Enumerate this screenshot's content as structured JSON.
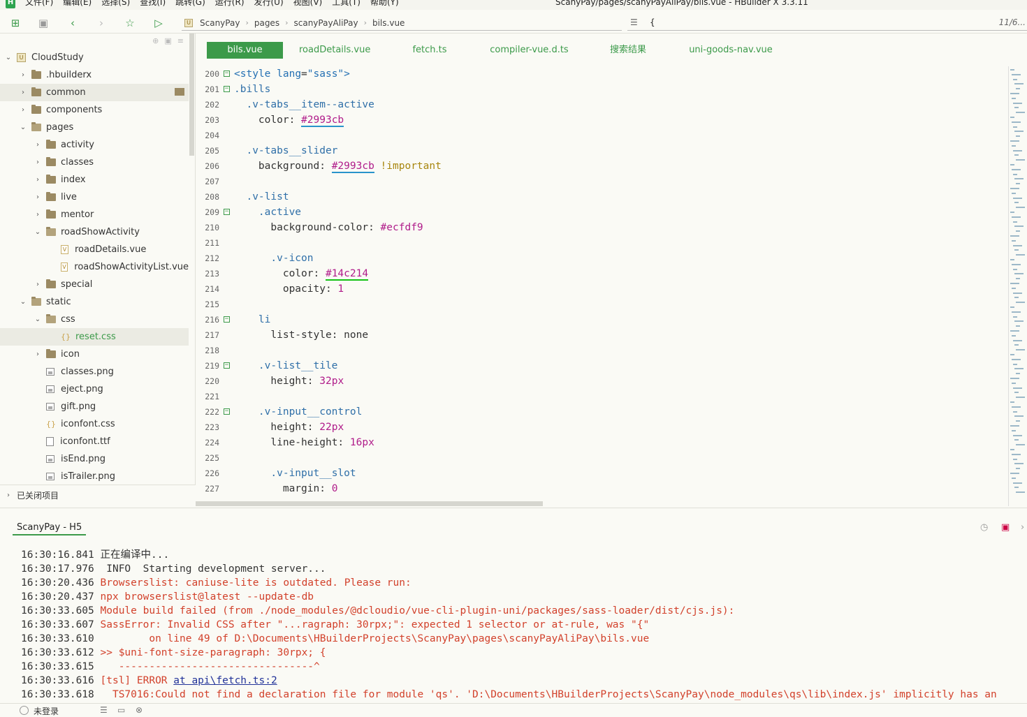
{
  "menu": {
    "logo": "H",
    "items": [
      "文件(F)",
      "编辑(E)",
      "选择(S)",
      "查找(I)",
      "跳转(G)",
      "运行(R)",
      "发行(U)",
      "视图(V)",
      "工具(T)",
      "帮助(Y)"
    ],
    "window_title": "ScanyPay/pages/scanyPayAliPay/bils.vue - HBuilder X 3.3.11"
  },
  "toolbar": {
    "buttons": [
      "new-file",
      "save",
      "back",
      "forward",
      "favorite",
      "run"
    ],
    "breadcrumb_logo": "U",
    "breadcrumb": [
      "ScanyPay",
      "pages",
      "scanyPayAliPay",
      "bils.vue"
    ],
    "search_value": "{",
    "search_count": "11/6..."
  },
  "sidebar": {
    "project_logo": "U",
    "tree": [
      {
        "label": "CloudStudy",
        "depth": 0,
        "type": "project",
        "expanded": true
      },
      {
        "label": ".hbuilderx",
        "depth": 1,
        "type": "folder",
        "expanded": false
      },
      {
        "label": "common",
        "depth": 1,
        "type": "folder",
        "expanded": false,
        "selected": true
      },
      {
        "label": "components",
        "depth": 1,
        "type": "folder",
        "expanded": false
      },
      {
        "label": "pages",
        "depth": 1,
        "type": "folder-open",
        "expanded": true
      },
      {
        "label": "activity",
        "depth": 2,
        "type": "folder",
        "expanded": false
      },
      {
        "label": "classes",
        "depth": 2,
        "type": "folder",
        "expanded": false
      },
      {
        "label": "index",
        "depth": 2,
        "type": "folder",
        "expanded": false
      },
      {
        "label": "live",
        "depth": 2,
        "type": "folder",
        "expanded": false
      },
      {
        "label": "mentor",
        "depth": 2,
        "type": "folder",
        "expanded": false
      },
      {
        "label": "roadShowActivity",
        "depth": 2,
        "type": "folder-open",
        "expanded": true
      },
      {
        "label": "roadDetails.vue",
        "depth": 3,
        "type": "vue"
      },
      {
        "label": "roadShowActivityList.vue",
        "depth": 3,
        "type": "vue"
      },
      {
        "label": "special",
        "depth": 2,
        "type": "folder",
        "expanded": false
      },
      {
        "label": "static",
        "depth": 1,
        "type": "folder-open",
        "expanded": true
      },
      {
        "label": "css",
        "depth": 2,
        "type": "folder-open",
        "expanded": true
      },
      {
        "label": "reset.css",
        "depth": 3,
        "type": "css",
        "selected": true,
        "active": true
      },
      {
        "label": "icon",
        "depth": 2,
        "type": "folder",
        "expanded": false
      },
      {
        "label": "classes.png",
        "depth": 2,
        "type": "image"
      },
      {
        "label": "eject.png",
        "depth": 2,
        "type": "image"
      },
      {
        "label": "gift.png",
        "depth": 2,
        "type": "image"
      },
      {
        "label": "iconfont.css",
        "depth": 2,
        "type": "css"
      },
      {
        "label": "iconfont.ttf",
        "depth": 2,
        "type": "plain"
      },
      {
        "label": "isEnd.png",
        "depth": 2,
        "type": "image"
      },
      {
        "label": "isTrailer.png",
        "depth": 2,
        "type": "image"
      }
    ],
    "closed_projects": "已关闭项目"
  },
  "tabs": [
    {
      "label": "bils.vue",
      "active": true
    },
    {
      "label": "roadDetails.vue"
    },
    {
      "label": "fetch.ts"
    },
    {
      "label": "compiler-vue.d.ts"
    },
    {
      "label": "搜索结果"
    },
    {
      "label": "uni-goods-nav.vue"
    }
  ],
  "code_lines": [
    {
      "n": "200",
      "fold": true,
      "html": "<span class=\"c-tag\">&lt;style</span> <span class=\"c-attr\">lang</span>=<span class=\"c-str\">\"sass\"</span><span class=\"c-tag\">&gt;</span>"
    },
    {
      "n": "201",
      "fold": true,
      "html": "<span class=\"c-sel\">.bills</span>"
    },
    {
      "n": "202",
      "fold": false,
      "html": "  <span class=\"c-sel\">.v-tabs__item--active</span>"
    },
    {
      "n": "203",
      "fold": false,
      "html": "    <span class=\"c-prop\">color</span>: <span class=\"c-color u-blue\">#2993cb</span>"
    },
    {
      "n": "204",
      "fold": false,
      "html": ""
    },
    {
      "n": "205",
      "fold": false,
      "html": "  <span class=\"c-sel\">.v-tabs__slider</span>"
    },
    {
      "n": "206",
      "fold": false,
      "html": "    <span class=\"c-prop\">background</span>: <span class=\"c-color u-blue\">#2993cb</span> <span class=\"c-imp\">!important</span>"
    },
    {
      "n": "207",
      "fold": false,
      "html": ""
    },
    {
      "n": "208",
      "fold": false,
      "html": "  <span class=\"c-sel\">.v-list</span>"
    },
    {
      "n": "209",
      "fold": true,
      "html": "    <span class=\"c-sel\">.active</span>"
    },
    {
      "n": "210",
      "fold": false,
      "html": "      <span class=\"c-prop\">background-color</span>: <span class=\"c-color\">#ecfdf9</span>"
    },
    {
      "n": "211",
      "fold": false,
      "html": ""
    },
    {
      "n": "212",
      "fold": false,
      "html": "      <span class=\"c-sel\">.v-icon</span>"
    },
    {
      "n": "213",
      "fold": false,
      "html": "        <span class=\"c-prop\">color</span>: <span class=\"c-color u-green\">#14c214</span>"
    },
    {
      "n": "214",
      "fold": false,
      "html": "        <span class=\"c-prop\">opacity</span>: <span class=\"c-num\">1</span>"
    },
    {
      "n": "215",
      "fold": false,
      "html": ""
    },
    {
      "n": "216",
      "fold": true,
      "html": "    <span class=\"c-sel\">li</span>"
    },
    {
      "n": "217",
      "fold": false,
      "html": "      <span class=\"c-prop\">list-style</span>: none"
    },
    {
      "n": "218",
      "fold": false,
      "html": ""
    },
    {
      "n": "219",
      "fold": true,
      "html": "    <span class=\"c-sel\">.v-list__tile</span>"
    },
    {
      "n": "220",
      "fold": false,
      "html": "      <span class=\"c-prop\">height</span>: <span class=\"c-num\">32</span><span class=\"c-unit\">px</span>"
    },
    {
      "n": "221",
      "fold": false,
      "html": ""
    },
    {
      "n": "222",
      "fold": true,
      "html": "    <span class=\"c-sel\">.v-input__control</span>"
    },
    {
      "n": "223",
      "fold": false,
      "html": "      <span class=\"c-prop\">height</span>: <span class=\"c-num\">22</span><span class=\"c-unit\">px</span>"
    },
    {
      "n": "224",
      "fold": false,
      "html": "      <span class=\"c-prop\">line-height</span>: <span class=\"c-num\">16</span><span class=\"c-unit\">px</span>"
    },
    {
      "n": "225",
      "fold": false,
      "html": ""
    },
    {
      "n": "226",
      "fold": false,
      "html": "      <span class=\"c-sel\">.v-input__slot</span>"
    },
    {
      "n": "227",
      "fold": false,
      "html": "        <span class=\"c-prop\">margin</span>: <span class=\"c-num\">0</span>"
    }
  ],
  "console": {
    "tab_label": "ScanyPay - H5",
    "logs": [
      {
        "time": "16:30:16.841",
        "text": "正在编译中...",
        "kind": "info"
      },
      {
        "time": "16:30:17.976",
        "text": " INFO  Starting development server...",
        "kind": "info"
      },
      {
        "time": "16:30:20.436",
        "text": "Browserslist: caniuse-lite is outdated. Please run:",
        "kind": "err"
      },
      {
        "time": "16:30:20.437",
        "text": "npx browserslist@latest --update-db",
        "kind": "err"
      },
      {
        "time": "16:30:33.605",
        "text": "Module build failed (from ./node_modules/@dcloudio/vue-cli-plugin-uni/packages/sass-loader/dist/cjs.js):",
        "kind": "err"
      },
      {
        "time": "16:30:33.607",
        "text": "SassError: Invalid CSS after \"...ragraph: 30rpx;\": expected 1 selector or at-rule, was \"{\"",
        "kind": "err"
      },
      {
        "time": "16:30:33.610",
        "text": "        on line 49 of D:\\Documents\\HBuilderProjects\\ScanyPay\\pages\\scanyPayAliPay\\bils.vue",
        "kind": "err"
      },
      {
        "time": "16:30:33.612",
        "text": ">> $uni-font-size-paragraph: 30rpx; {",
        "kind": "err"
      },
      {
        "time": "16:30:33.615",
        "text": "   --------------------------------^",
        "kind": "err"
      },
      {
        "time": "16:30:33.616",
        "text": "[tsl] ERROR ",
        "link": "at api\\fetch.ts:2",
        "kind": "err"
      },
      {
        "time": "16:30:33.618",
        "text": "  TS7016:Could not find a declaration file for module 'qs'. 'D:\\Documents\\HBuilderProjects\\ScanyPay\\node_modules\\qs\\lib\\index.js' implicitly has an",
        "kind": "err"
      }
    ]
  },
  "status": {
    "user": "未登录"
  }
}
